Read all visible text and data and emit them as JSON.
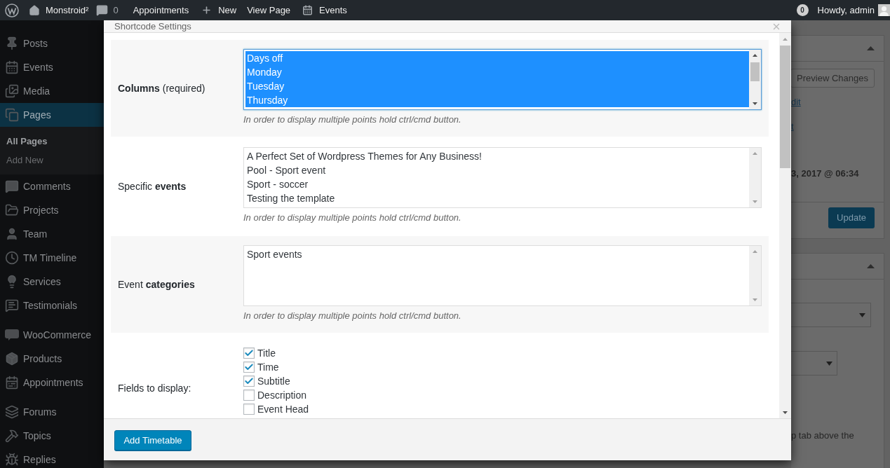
{
  "admin_bar": {
    "site": "Monstroid²",
    "comments": "0",
    "items": [
      {
        "label": "Appointments"
      },
      {
        "label": "New"
      },
      {
        "label": "View Page"
      },
      {
        "label": "Events"
      }
    ],
    "notifications": "0",
    "account": "Howdy, admin"
  },
  "sidebar": {
    "groups": [
      {
        "items": [
          {
            "label": "Posts",
            "selected": false
          },
          {
            "label": "Events",
            "selected": false
          },
          {
            "label": "Media",
            "selected": false
          },
          {
            "label": "Pages",
            "selected": true,
            "children": [
              {
                "label": "All Pages",
                "selected": true
              },
              {
                "label": "Add New",
                "selected": false
              }
            ]
          },
          {
            "label": "Comments",
            "selected": false
          },
          {
            "label": "Projects",
            "selected": false
          },
          {
            "label": "Team",
            "selected": false
          },
          {
            "label": "TM Timeline",
            "selected": false
          },
          {
            "label": "Services",
            "selected": false
          },
          {
            "label": "Testimonials",
            "selected": false
          }
        ]
      },
      {
        "items": [
          {
            "label": "WooCommerce",
            "selected": false
          },
          {
            "label": "Products",
            "selected": false
          },
          {
            "label": "Appointments",
            "selected": false
          }
        ]
      },
      {
        "items": [
          {
            "label": "Forums",
            "selected": false
          },
          {
            "label": "Topics",
            "selected": false
          },
          {
            "label": "Replies",
            "selected": false
          }
        ]
      }
    ]
  },
  "editor_sidebar": {
    "preview_button": "Preview Changes",
    "links": [
      "dit",
      "t"
    ],
    "publish_date": "3, 2017 @ 06:34",
    "update_button": "Update",
    "help_text": "p tab above the"
  },
  "dialog": {
    "title": "Shortcode Settings",
    "rows": [
      {
        "kind": "multiselect",
        "label": "**Columns** (required)",
        "focused": true,
        "options": [
          {
            "label": "Days off",
            "selected": true
          },
          {
            "label": "Monday",
            "selected": true
          },
          {
            "label": "Tuesday",
            "selected": true
          },
          {
            "label": "Thursday",
            "selected": true
          }
        ],
        "hint": "In order to display multiple points hold ctrl/cmd button."
      },
      {
        "kind": "multiselect",
        "label": "Specific **events**",
        "focused": false,
        "options": [
          {
            "label": "A Perfect Set of Wordpress Themes for Any Business!",
            "selected": false
          },
          {
            "label": "Pool - Sport event",
            "selected": false
          },
          {
            "label": "Sport - soccer",
            "selected": false
          },
          {
            "label": "Testing the template",
            "selected": false
          }
        ],
        "hint": "In order to display multiple points hold ctrl/cmd button."
      },
      {
        "kind": "multiselect",
        "label": "Event **categories**",
        "focused": false,
        "options": [
          {
            "label": "Sport events",
            "selected": false
          }
        ],
        "hint": "In order to display multiple points hold ctrl/cmd button."
      },
      {
        "kind": "checkboxes",
        "label": "Fields to display:",
        "options": [
          {
            "label": "Title",
            "checked": true
          },
          {
            "label": "Time",
            "checked": true
          },
          {
            "label": "Subtitle",
            "checked": true
          },
          {
            "label": "Description",
            "checked": false
          },
          {
            "label": "Event Head",
            "checked": false
          }
        ]
      }
    ],
    "submit_button": "Add Timetable"
  }
}
